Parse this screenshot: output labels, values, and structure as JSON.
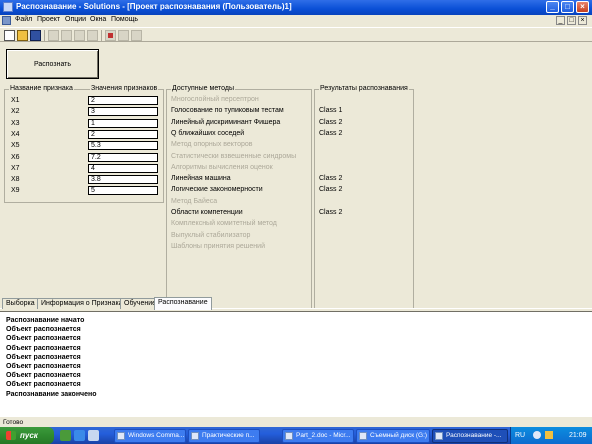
{
  "window": {
    "title": "Распознавание - Solutions - [Проект распознавания (Пользователь)1]",
    "controls": {
      "minimize": "_",
      "maximize": "□",
      "close": "×"
    }
  },
  "menu": {
    "items": [
      "Файл",
      "Проект",
      "Опции",
      "Окна",
      "Помощь"
    ],
    "mdi_controls": {
      "minimize": "_",
      "restore": "□",
      "close": "×"
    }
  },
  "toolbar": {
    "buttons": [
      "new-icon",
      "open-icon",
      "save-icon",
      "tool-icon",
      "tool-icon",
      "tool-icon",
      "tool-icon",
      "tool-icon",
      "tool-icon",
      "tool-icon"
    ]
  },
  "main": {
    "recognize_button": "Распознать",
    "features": {
      "name_header": "Название признака",
      "value_header": "Значения признаков",
      "rows": [
        {
          "name": "X1",
          "value": "2"
        },
        {
          "name": "X2",
          "value": "3"
        },
        {
          "name": "X3",
          "value": "1"
        },
        {
          "name": "X4",
          "value": "2"
        },
        {
          "name": "X5",
          "value": "5.3"
        },
        {
          "name": "X6",
          "value": "7.2"
        },
        {
          "name": "X7",
          "value": "4"
        },
        {
          "name": "X8",
          "value": "3.8"
        },
        {
          "name": "X9",
          "value": "5"
        }
      ]
    },
    "methods": {
      "header": "Доступные методы",
      "items": [
        {
          "label": "Многослойный персептрон",
          "enabled": false
        },
        {
          "label": "Голосование по тупиковым тестам",
          "enabled": true
        },
        {
          "label": "Линейный дискриминант Фишера",
          "enabled": true
        },
        {
          "label": "Q ближайших соседей",
          "enabled": true
        },
        {
          "label": "Метод опорных векторов",
          "enabled": false
        },
        {
          "label": "Статистически взвешенные синдромы",
          "enabled": false
        },
        {
          "label": "Алгоритмы вычисления оценок",
          "enabled": false
        },
        {
          "label": "Линейная машина",
          "enabled": true
        },
        {
          "label": "Логические закономерности",
          "enabled": true
        },
        {
          "label": "Метод Байеса",
          "enabled": false
        },
        {
          "label": "Области компетенции",
          "enabled": true
        },
        {
          "label": "Комплексный комитетный метод",
          "enabled": false
        },
        {
          "label": "Выпуклый стабилизатор",
          "enabled": false
        },
        {
          "label": "Шаблоны принятия решений",
          "enabled": false
        }
      ]
    },
    "results": {
      "header": "Результаты распознавания",
      "items": [
        "",
        "Class 1",
        "Class 2",
        "Class 2",
        "",
        "",
        "",
        "Class 2",
        "Class 2",
        "",
        "Class 2",
        "",
        "",
        ""
      ]
    }
  },
  "tabs": [
    {
      "label": "Выборка",
      "active": false
    },
    {
      "label": "Информация о Признаках",
      "active": false
    },
    {
      "label": "Обучение",
      "active": false
    },
    {
      "label": "Распознавание",
      "active": true
    }
  ],
  "log": {
    "lines": [
      "Распознавание начато",
      "Объект распознается",
      "Объект распознается",
      "Объект распознается",
      "Объект распознается",
      "Объект распознается",
      "Объект распознается",
      "Объект распознается",
      "Распознавание закончено"
    ]
  },
  "status": {
    "text": "Готово"
  },
  "taskbar": {
    "start": "пуск",
    "tasks": [
      {
        "label": "Windows Comma...",
        "active": false
      },
      {
        "label": "Практические п...",
        "active": false
      },
      {
        "label": "Part_2.doc - Micr...",
        "active": false
      },
      {
        "label": "Съемный диск (G:)",
        "active": false
      },
      {
        "label": "Распознавание -...",
        "active": true
      }
    ],
    "tray": {
      "language": "RU",
      "time": "21:09"
    }
  },
  "colors": {
    "titlebar": "#0a4fd6",
    "window_bg": "#ece9d8",
    "disabled_text": "#aca899",
    "taskbar": "#245edb",
    "start_button": "#2f8a2f"
  }
}
